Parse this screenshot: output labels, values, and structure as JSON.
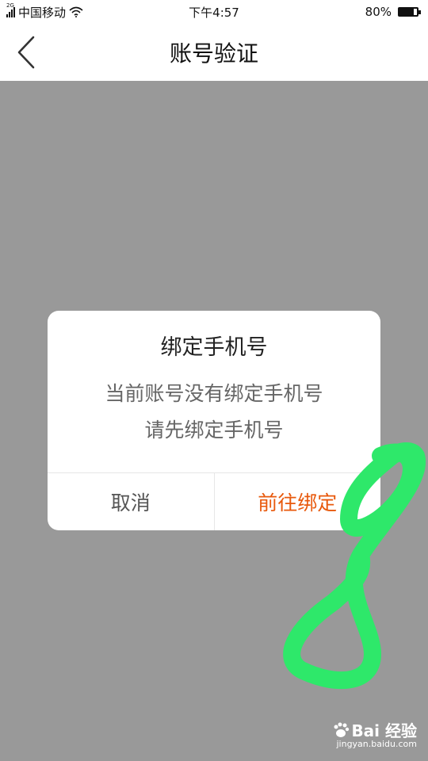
{
  "status_bar": {
    "network_type": "2G",
    "carrier": "中国移动",
    "time": "下午4:57",
    "battery_percent": "80%",
    "battery_level": 0.8
  },
  "nav": {
    "title": "账号验证",
    "back_icon": "chevron-left-icon"
  },
  "dialog": {
    "title": "绑定手机号",
    "message_line1": "当前账号没有绑定手机号",
    "message_line2": "请先绑定手机号",
    "cancel_label": "取消",
    "confirm_label": "前往绑定",
    "confirm_color": "#e8590c"
  },
  "annotation": {
    "icon": "figure-eight-annotation",
    "color": "#2ee86a"
  },
  "watermark": {
    "brand": "Bai 经验",
    "url": "jingyan.baidu.com"
  },
  "colors": {
    "overlay": "#999999",
    "surface": "#ffffff"
  }
}
